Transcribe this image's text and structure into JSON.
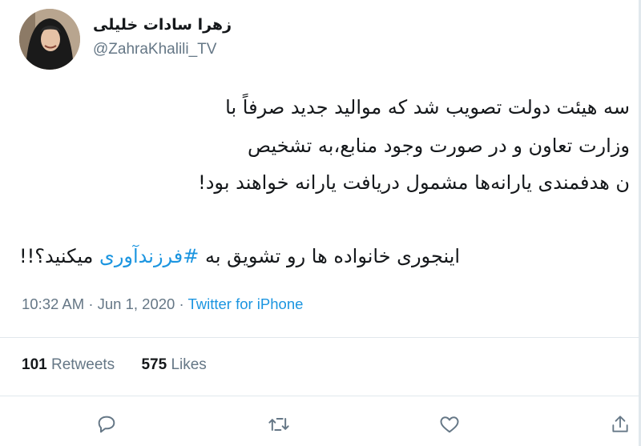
{
  "author": {
    "display_name": "زهرا سادات خلیلی",
    "username": "@ZahraKhalili_TV"
  },
  "tweet": {
    "lines": [
      "سه هیئت دولت تصویب شد که موالید جدید صرفاً با",
      "وزارت تعاون و در صورت وجود منابع،به تشخیص",
      "ن هدفمندی یارانه‌ها مشمول دریافت یارانه خواهند بود!"
    ],
    "last_line": {
      "before": "اینجوری خانواده ها رو تشویق به ",
      "hashtag": "#فرزندآوری",
      "after": " میکنید؟!!"
    }
  },
  "meta": {
    "time": "10:32 AM",
    "date": "Jun 1, 2020",
    "separator": "·",
    "source": "Twitter for iPhone"
  },
  "stats": {
    "retweets_count": "101",
    "retweets_label": "Retweets",
    "likes_count": "575",
    "likes_label": "Likes"
  },
  "actions": [
    "reply-icon",
    "retweet-icon",
    "like-icon",
    "share-icon"
  ],
  "colors": {
    "text": "#14171a",
    "secondary": "#657786",
    "link": "#1b95e0",
    "divider": "#e1e8ed"
  }
}
